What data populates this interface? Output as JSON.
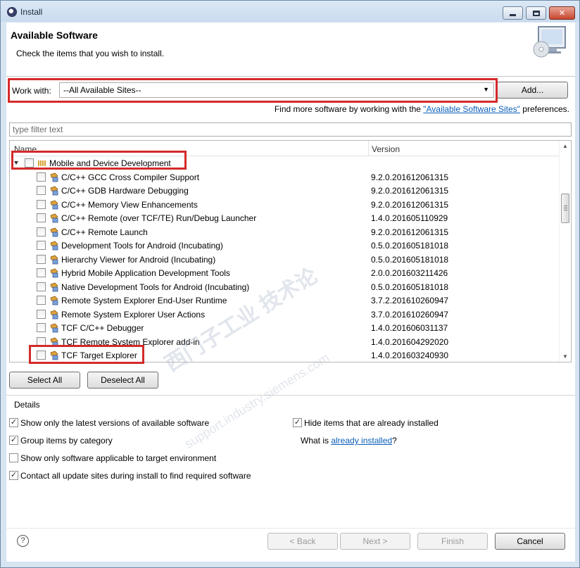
{
  "window": {
    "title": "Install"
  },
  "header": {
    "title": "Available Software",
    "description": "Check the items that you wish to install."
  },
  "work_with": {
    "label": "Work with:",
    "value": "--All Available Sites--",
    "add_label": "Add..."
  },
  "find_more": {
    "prefix": "Find more software by working with the ",
    "link": "\"Available Software Sites\"",
    "suffix": " preferences."
  },
  "filter": {
    "placeholder": "type filter text"
  },
  "table": {
    "columns": [
      "Name",
      "Version"
    ],
    "category": {
      "label": "Mobile and Device Development"
    },
    "rows": [
      {
        "name": "C/C++ GCC Cross Compiler Support",
        "version": "9.2.0.201612061315"
      },
      {
        "name": "C/C++ GDB Hardware Debugging",
        "version": "9.2.0.201612061315"
      },
      {
        "name": "C/C++ Memory View Enhancements",
        "version": "9.2.0.201612061315"
      },
      {
        "name": "C/C++ Remote (over TCF/TE) Run/Debug Launcher",
        "version": "1.4.0.201605110929"
      },
      {
        "name": "C/C++ Remote Launch",
        "version": "9.2.0.201612061315"
      },
      {
        "name": "Development Tools for Android (Incubating)",
        "version": "0.5.0.201605181018"
      },
      {
        "name": "Hierarchy Viewer for Android (Incubating)",
        "version": "0.5.0.201605181018"
      },
      {
        "name": "Hybrid Mobile Application Development Tools",
        "version": "2.0.0.201603211426"
      },
      {
        "name": "Native Development Tools for Android (Incubating)",
        "version": "0.5.0.201605181018"
      },
      {
        "name": "Remote System Explorer End-User Runtime",
        "version": "3.7.2.201610260947"
      },
      {
        "name": "Remote System Explorer User Actions",
        "version": "3.7.0.201610260947"
      },
      {
        "name": "TCF C/C++ Debugger",
        "version": "1.4.0.201606031137"
      },
      {
        "name": "TCF Remote System Explorer add-in",
        "version": "1.4.0.201604292020"
      },
      {
        "name": "TCF Target Explorer",
        "version": "1.4.0.201603240930"
      }
    ]
  },
  "buttons": {
    "select_all": "Select All",
    "deselect_all": "Deselect All",
    "back": "< Back",
    "next": "Next >",
    "finish": "Finish",
    "cancel": "Cancel"
  },
  "details": {
    "label": "Details",
    "latest_versions": {
      "label": "Show only the latest versions of available software",
      "checked": true
    },
    "hide_installed": {
      "label": "Hide items that are already installed",
      "checked": true
    },
    "group_by_category": {
      "label": "Group items by category",
      "checked": true
    },
    "what_is_prefix": "What is ",
    "what_is_link": "already installed",
    "what_is_suffix": "?",
    "applicable_only": {
      "label": "Show only software applicable to target environment",
      "checked": false
    },
    "contact_sites": {
      "label": "Contact all update sites during install to find required software",
      "checked": true
    }
  },
  "watermark": {
    "line1": "西门子工业 技术论",
    "line2": "support.industry.siemens.com"
  },
  "colors": {
    "annotation": "#d42a2a",
    "link": "#0b5eb8",
    "window_frame": "#d7e4f2"
  }
}
